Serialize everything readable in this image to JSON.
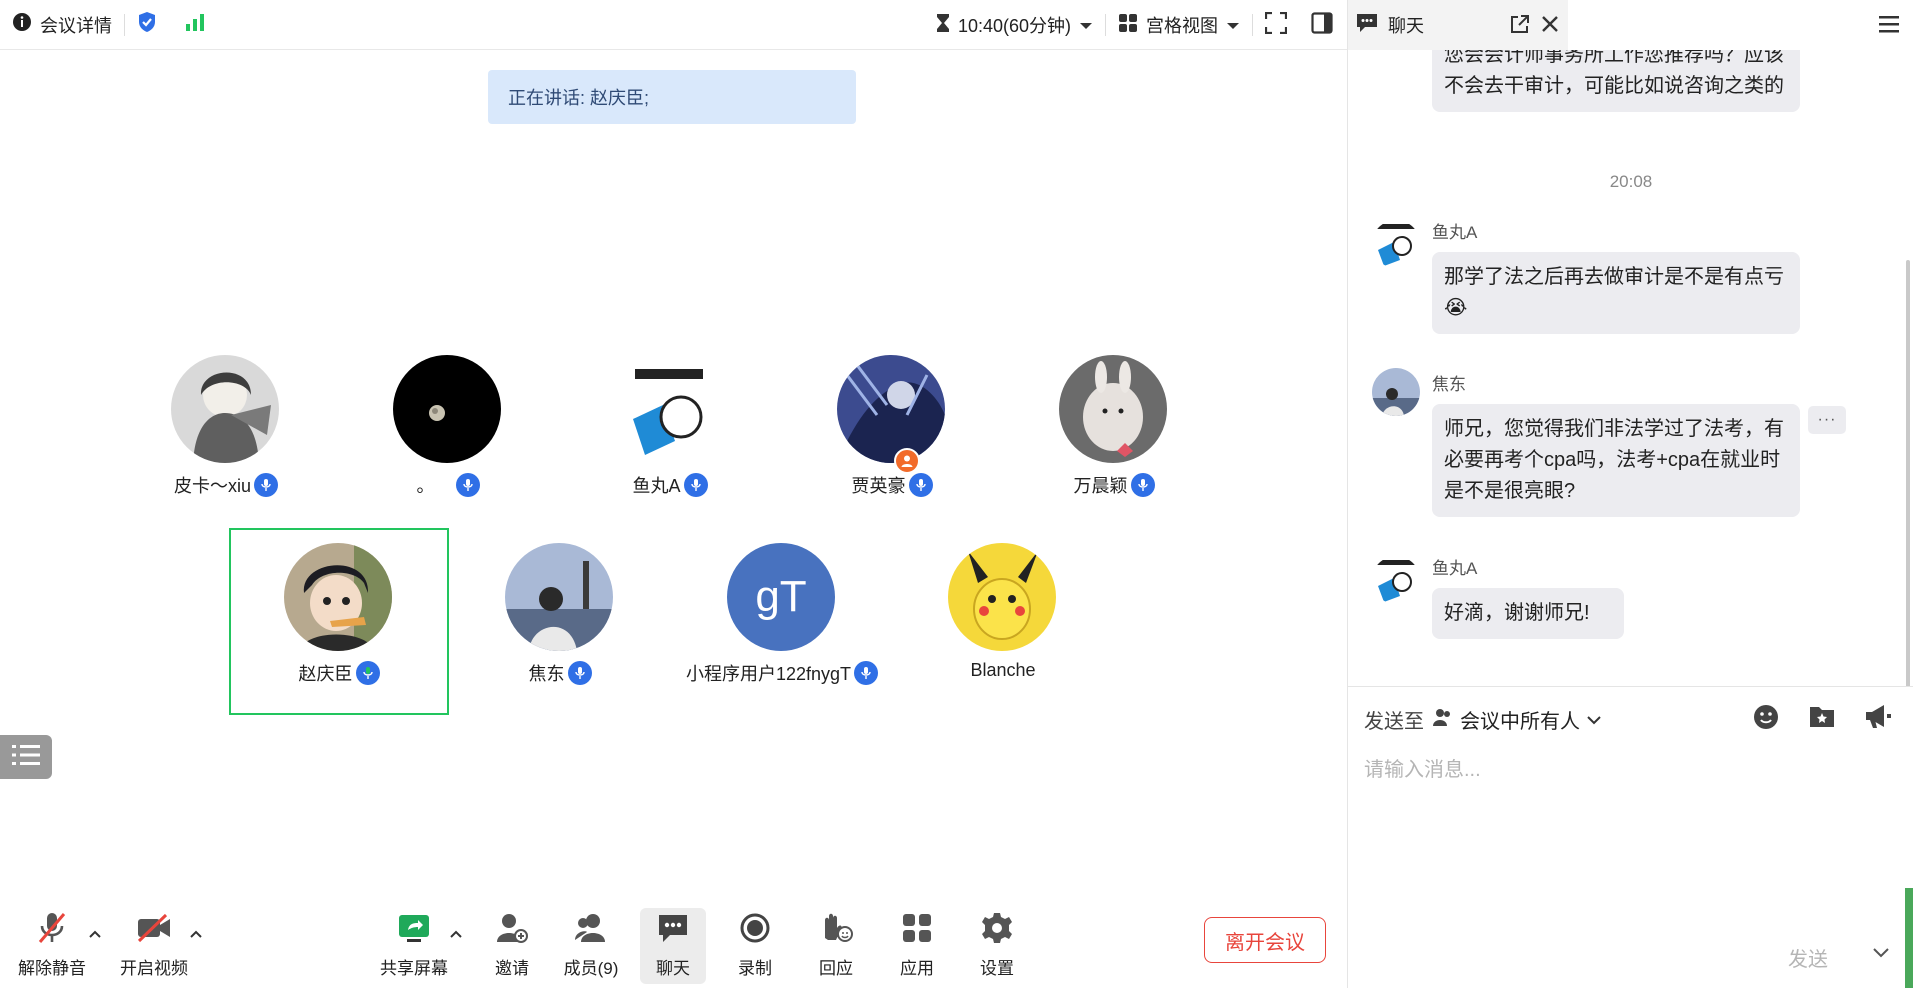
{
  "topbar": {
    "meeting_details": "会议详情",
    "time_label": "10:40(60分钟)",
    "view_label": "宫格视图"
  },
  "speaking_banner": "正在讲话: 赵庆臣;",
  "participants": [
    {
      "name": "皮卡～xiu",
      "mic": "on"
    },
    {
      "name": "。",
      "mic": "on"
    },
    {
      "name": "鱼丸A",
      "mic": "on"
    },
    {
      "name": "贾英豪",
      "mic": "on"
    },
    {
      "name": "万晨颖",
      "mic": "on"
    },
    {
      "name": "赵庆臣",
      "mic": "speaking"
    },
    {
      "name": "焦东",
      "mic": "on"
    },
    {
      "name": "小程序用户122fnygT",
      "mic": "on"
    },
    {
      "name": "Blanche",
      "mic": "none"
    }
  ],
  "avatar_initials": "gT",
  "toolbar": {
    "unmute": "解除静音",
    "start_video": "开启视频",
    "share_screen": "共享屏幕",
    "invite": "邀请",
    "members": "成员(9)",
    "chat": "聊天",
    "record": "录制",
    "react": "回应",
    "apps": "应用",
    "settings": "设置",
    "leave": "离开会议"
  },
  "chat": {
    "tab_title": "聊天",
    "partial_message": "您会会计师事务所工作您推荐吗？应该不会去干审计，可能比如说咨询之类的",
    "time_separator": "20:08",
    "messages": [
      {
        "sender": "鱼丸A",
        "text": "那学了法之后再去做审计是不是有点亏😭"
      },
      {
        "sender": "焦东",
        "text": "师兄，您觉得我们非法学过了法考，有必要再考个cpa吗，法考+cpa在就业时是不是很亮眼?"
      },
      {
        "sender": "鱼丸A",
        "text": "好滴，谢谢师兄!"
      }
    ],
    "more_button": "···",
    "send_to_label": "发送至",
    "send_to_target": "会议中所有人",
    "input_placeholder": "请输入消息...",
    "send_label": "发送"
  },
  "colors": {
    "accent_blue": "#2f6fe6",
    "speaker_green": "#22c55e",
    "leave_red": "#e8453c",
    "banner_bg": "#d9e8fb"
  }
}
